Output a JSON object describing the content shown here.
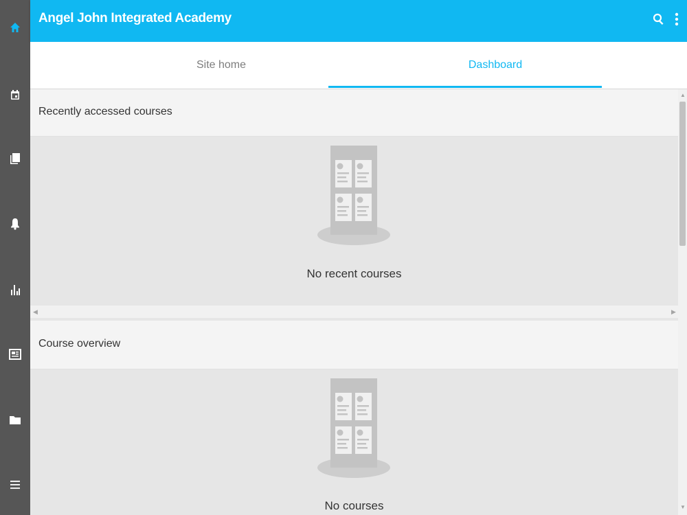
{
  "app": {
    "title": "Angel John Integrated Academy",
    "accent_color": "#10b8f2",
    "rail_color": "#565656"
  },
  "rail": {
    "items": [
      {
        "icon": "home-icon",
        "active": true
      },
      {
        "icon": "calendar-icon"
      },
      {
        "icon": "book-icon"
      },
      {
        "icon": "bell-icon"
      },
      {
        "icon": "grades-chart-icon"
      },
      {
        "icon": "news-icon"
      },
      {
        "icon": "folder-icon"
      },
      {
        "icon": "menu-icon"
      }
    ]
  },
  "toolbar": {
    "search_icon": "search-icon",
    "more_icon": "more-vert-icon"
  },
  "tabs": [
    {
      "label": "Site home",
      "active": false
    },
    {
      "label": "Dashboard",
      "active": true
    }
  ],
  "sections": {
    "recent": {
      "title": "Recently accessed courses",
      "empty_text": "No recent courses"
    },
    "overview": {
      "title": "Course overview",
      "empty_text": "No courses"
    }
  }
}
